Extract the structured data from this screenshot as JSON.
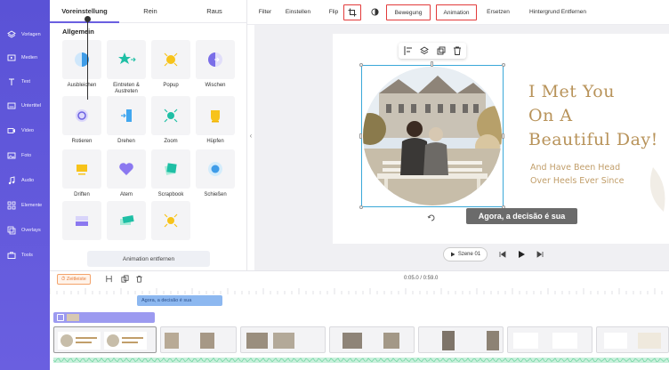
{
  "sidebar": {
    "items": [
      {
        "label": "Vorlagen",
        "icon": "layers-icon"
      },
      {
        "label": "Medien",
        "icon": "media-icon"
      },
      {
        "label": "Text",
        "icon": "text-icon"
      },
      {
        "label": "Untertitel",
        "icon": "subtitle-icon"
      },
      {
        "label": "Video",
        "icon": "video-icon"
      },
      {
        "label": "Foto",
        "icon": "photo-icon"
      },
      {
        "label": "Audio",
        "icon": "music-icon"
      },
      {
        "label": "Elemente",
        "icon": "elements-icon"
      },
      {
        "label": "Overlays",
        "icon": "overlay-icon"
      },
      {
        "label": "Tools",
        "icon": "toolbox-icon"
      }
    ]
  },
  "panel": {
    "tabs": [
      "Voreinstellung",
      "Rein",
      "Raus"
    ],
    "section_title": "Allgemein",
    "effects": [
      "Ausbleichen",
      "Eintreten & Austreten",
      "Popup",
      "Wischen",
      "Rotieren",
      "Drehen",
      "Zoom",
      "Hüpfen",
      "Driften",
      "Atem",
      "Scrapbook",
      "Schießen",
      "",
      "",
      ""
    ],
    "remove_button": "Animation entfernen"
  },
  "toolbar": {
    "filter": "Filter",
    "adjust": "Einstellen",
    "flip": "Flip",
    "motion": "Bewegung",
    "animation": "Animation",
    "replace": "Ersetzen",
    "remove_bg": "Hintergrund Entfernen"
  },
  "canvas": {
    "heading_lines": [
      "I Met You",
      "On A",
      "Beautiful Day!"
    ],
    "subheading_lines": [
      "And Have Been Head",
      "Over Heels Ever Since"
    ],
    "caption": "Agora, a decisão é sua",
    "scene_button": "Szene 01"
  },
  "timeline": {
    "badge": "Zeitleiste",
    "time": "0:05.0 / 0:59.0",
    "caption_clip": "Agora, a decisão é sua"
  },
  "colors": {
    "sidebar": "#5a52d6",
    "accent": "#6a5fe0",
    "highlight_border": "#e23a3a",
    "heading_gold": "#b8935a"
  }
}
